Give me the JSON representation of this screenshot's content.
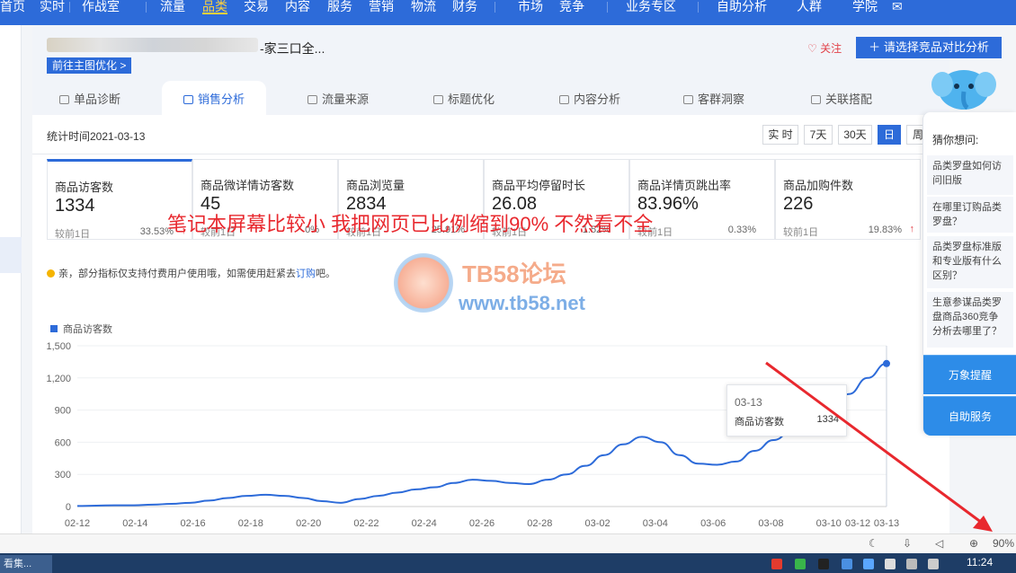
{
  "nav": {
    "items": [
      "首页",
      "实时",
      "作战室",
      "流量",
      "品类",
      "交易",
      "内容",
      "服务",
      "营销",
      "物流",
      "财务",
      "市场",
      "竞争",
      "业务专区",
      "自助分析",
      "人群",
      "学院"
    ],
    "active": "品类"
  },
  "product": {
    "title": "-家三口全...",
    "main_button": "前往主图优化 >",
    "follow": "关注",
    "compare_button": "请选择竞品对比分析"
  },
  "tabs": [
    "单品诊断",
    "销售分析",
    "流量来源",
    "标题优化",
    "内容分析",
    "客群洞察",
    "关联搭配"
  ],
  "date": {
    "label": "统计时间2021-03-13",
    "buttons": [
      "实 时",
      "7天",
      "30天",
      "日",
      "周"
    ]
  },
  "metrics": [
    {
      "name": "商品访客数",
      "value": "1334",
      "cmp": "较前1日",
      "pct": "33.53%"
    },
    {
      "name": "商品微详情访客数",
      "value": "45",
      "cmp": "较前1日",
      "pct": "0%"
    },
    {
      "name": "商品浏览量",
      "value": "2834",
      "cmp": "较前1日",
      "pct": "25.91%"
    },
    {
      "name": "商品平均停留时长",
      "value": "26.08",
      "cmp": "较前1日",
      "pct": "1.52%"
    },
    {
      "name": "商品详情页跳出率",
      "value": "83.96%",
      "cmp": "较前1日",
      "pct": "0.33%"
    },
    {
      "name": "商品加购件数",
      "value": "226",
      "cmp": "较前1日",
      "pct": "19.83%"
    }
  ],
  "notice": {
    "text": "亲，部分指标仅支持付费用户使用哦，如需使用赶紧去",
    "link": "订购",
    "suffix": "吧。"
  },
  "overlay_text": "笔记本屏幕比较小 我把网页已比例缩到90% 不然看不全",
  "watermark": {
    "line1": "TB58论坛",
    "line2": "www.tb58.net"
  },
  "chart_data": {
    "type": "line",
    "series": [
      {
        "name": "商品访客数",
        "values": [
          5,
          8,
          12,
          12,
          18,
          25,
          35,
          55,
          80,
          100,
          110,
          100,
          80,
          50,
          35,
          70,
          100,
          130,
          160,
          180,
          220,
          250,
          240,
          220,
          210,
          250,
          300,
          380,
          480,
          580,
          650,
          600,
          480,
          400,
          390,
          420,
          520,
          620,
          710,
          800,
          900,
          1050,
          1200,
          1334
        ]
      }
    ],
    "x": [
      "02-12",
      "02-14",
      "02-16",
      "02-18",
      "02-20",
      "02-22",
      "02-24",
      "02-26",
      "02-28",
      "03-02",
      "03-04",
      "03-06",
      "03-08",
      "03-10",
      "03-12",
      "03-13"
    ],
    "ylim": [
      0,
      1500
    ],
    "yticks": [
      "0",
      "300",
      "600",
      "900",
      "1,200",
      "1,500"
    ],
    "tooltip": {
      "date": "03-13",
      "name": "商品访客数",
      "value": "1334"
    }
  },
  "helper": {
    "title": "猜你想问:",
    "items": [
      "品类罗盘如何访问旧版",
      "在哪里订购品类罗盘？",
      "品类罗盘标准版和专业版有什么区别？",
      "生意参谋品类罗盘商品360竞争分析去哪里了？"
    ],
    "btn1": "万象提醒",
    "btn2": "自助服务"
  },
  "status": {
    "zoom": "90%"
  },
  "taskbar": {
    "app": "看集...",
    "time": "11:24"
  }
}
